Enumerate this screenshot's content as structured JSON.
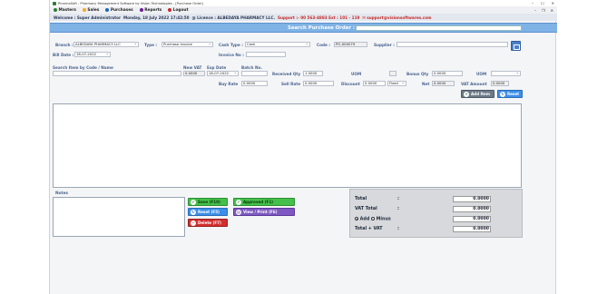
{
  "window": {
    "title": "PharmaSoft - Pharmacy Management Software by Vision Technologies - [Purchase Order]",
    "controls": [
      "–",
      "☐",
      "✕"
    ]
  },
  "menu": {
    "items": [
      {
        "label": "Masters",
        "icon": "masters-icon",
        "color": "#2e7d32"
      },
      {
        "label": "Sales",
        "icon": "sales-icon",
        "color": "#f9a825"
      },
      {
        "label": "Purchases",
        "icon": "purchases-icon",
        "color": "#1565c0"
      },
      {
        "label": "Reports",
        "icon": "reports-icon",
        "color": "#6a1b9a"
      },
      {
        "label": "Logout",
        "icon": "logout-icon",
        "color": "#c62828"
      }
    ],
    "mdi_controls": [
      "–",
      "❐",
      "✕"
    ]
  },
  "infobar": {
    "welcome": "Welcome : Super Administrator",
    "date": "Monday, 18 July 2022 17:42:50",
    "licence": "@ Licence : ALBEDAYA PHARMACY LLC.",
    "support_phone": "Support :- 00 563-4883 Ext : 101 - 119",
    "support_email": "✉ support@visionsoftwares.com"
  },
  "search": {
    "label": "Search Purchase Order :",
    "value": ""
  },
  "header": {
    "branch_label": "Branch :",
    "branch_value": "ALBEDAYA PHARMACY LLC",
    "type_label": "Type :",
    "type_value": "Purchase Invoice",
    "cash_type_label": "Cash Type :",
    "cash_type_value": "Cash",
    "code_label": "Code :",
    "code_value": "PO-000079",
    "supplier_label": "Supplier :",
    "supplier_value": "",
    "bill_date_label": "Bill Date :",
    "bill_date_value": "18-07-2022",
    "invoice_no_label": "Invoice No :",
    "invoice_no_value": ""
  },
  "item": {
    "search_label": "Search Item by Code / Name",
    "new_vat_label": "New VAT",
    "new_vat_value": "0.0000",
    "exp_date_label": "Exp Date",
    "exp_date_value": "18-07-2022",
    "batch_label": "Batch No.",
    "received_qty_label": "Received Qty",
    "received_qty_value": "1.0000",
    "uom_label": "UOM",
    "bonus_qty_label": "Bonus Qty",
    "bonus_qty_value": "0.0000",
    "uom2_label": "UOM",
    "buy_rate_label": "Buy Rate",
    "buy_rate_value": "0.0000",
    "sell_rate_label": "Sell Rate",
    "sell_rate_value": "0.0000",
    "discount_label": "Discount",
    "discount_value": "0.0000",
    "discount_type": "Fixed",
    "net_label": "Net",
    "net_value": "0.0000",
    "vat_amount_label": "VAT Amount",
    "vat_amount_value": "0.0000",
    "add_label": "Add Item",
    "reset_label": "Reset"
  },
  "notes": {
    "label": "Notes"
  },
  "buttons": {
    "save": "Save (F10)",
    "approved": "Approved (F1)",
    "reset": "Reset (F5)",
    "view_print": "View / Print (F6)",
    "delete": "Delete (F7)"
  },
  "totals": {
    "total_label": "Total",
    "total_value": "0.0000",
    "vat_total_label": "VAT Total",
    "vat_total_value": "0.0000",
    "add_label": "Add",
    "minus_label": "Minus",
    "add_minus_value": "0.0000",
    "total_vat_label": "Total + VAT",
    "total_vat_value": "0.0000",
    "colon": ":"
  },
  "colors": {
    "accent": "#7fb3e6",
    "label": "#4a6590",
    "save": "#44c04a",
    "delete": "#d32f2f"
  }
}
